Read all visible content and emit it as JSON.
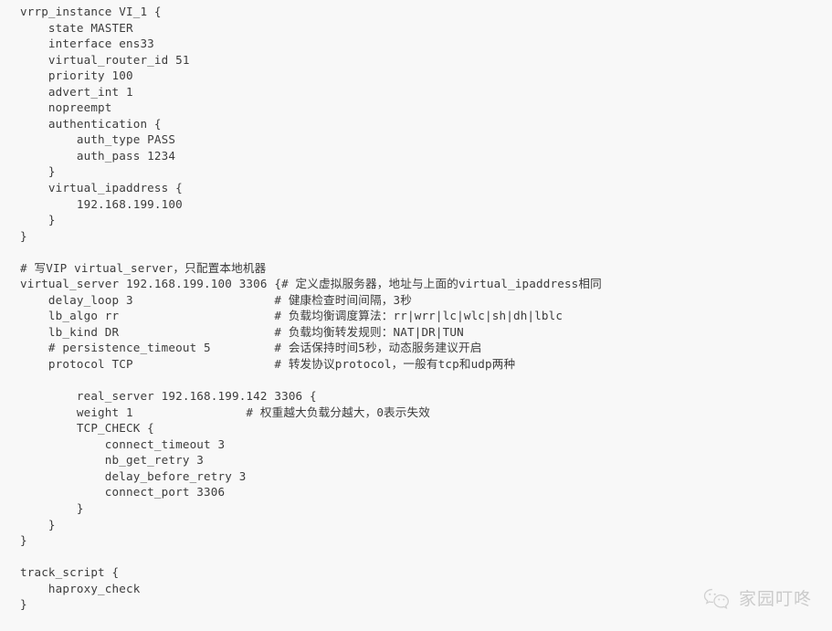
{
  "document": {
    "kind": "code-listing",
    "language": "keepalived-conf",
    "background_color": "#f8f8f8",
    "text_color": "#3c3c3c",
    "lines": [
      "vrrp_instance VI_1 {",
      "    state MASTER",
      "    interface ens33",
      "    virtual_router_id 51",
      "    priority 100",
      "    advert_int 1",
      "    nopreempt",
      "    authentication {",
      "        auth_type PASS",
      "        auth_pass 1234",
      "    }",
      "    virtual_ipaddress {",
      "        192.168.199.100",
      "    }",
      "}",
      "",
      "# 写VIP virtual_server，只配置本地机器",
      "virtual_server 192.168.199.100 3306 {# 定义虚拟服务器，地址与上面的virtual_ipaddress相同",
      "    delay_loop 3                    # 健康检查时间间隔，3秒",
      "    lb_algo rr                      # 负载均衡调度算法：rr|wrr|lc|wlc|sh|dh|lblc",
      "    lb_kind DR                      # 负载均衡转发规则：NAT|DR|TUN",
      "    # persistence_timeout 5         # 会话保持时间5秒，动态服务建议开启",
      "    protocol TCP                    # 转发协议protocol，一般有tcp和udp两种",
      "",
      "        real_server 192.168.199.142 3306 {",
      "        weight 1                # 权重越大负载分越大，0表示失效",
      "        TCP_CHECK {",
      "            connect_timeout 3",
      "            nb_get_retry 3",
      "            delay_before_retry 3",
      "            connect_port 3306",
      "        }",
      "    }",
      "}",
      "",
      "track_script {",
      "    haproxy_check",
      "}"
    ]
  },
  "watermark": {
    "icon": "wechat-icon",
    "label": "家园叮咚",
    "color": "#c9c9c9"
  }
}
